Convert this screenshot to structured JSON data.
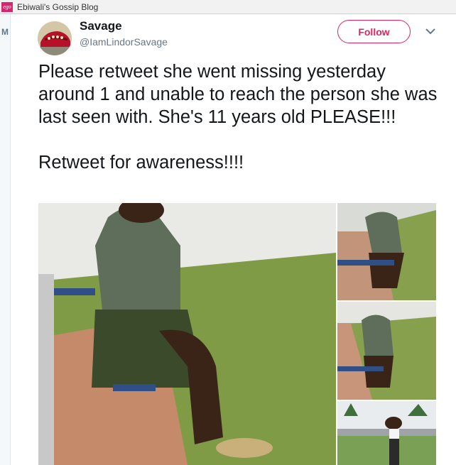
{
  "browser": {
    "bookmark_title": "Ebiwali's Gossip Blog",
    "favicon_text": "ego"
  },
  "left_strip": {
    "letter": "M"
  },
  "tweet": {
    "display_name": "Savage",
    "handle": "@IamLindorSavage",
    "follow_label": "Follow",
    "text_para1": "Please retweet she went missing yesterday around 1 and unable to reach the person she was last seen with. She's 11 years old PLEASE!!!",
    "text_para2": "Retweet for awareness!!!!"
  },
  "colors": {
    "accent": "#e0245e",
    "text": "#14171a",
    "muted": "#657786"
  },
  "icons": {
    "menu": "chevron-down-icon"
  }
}
